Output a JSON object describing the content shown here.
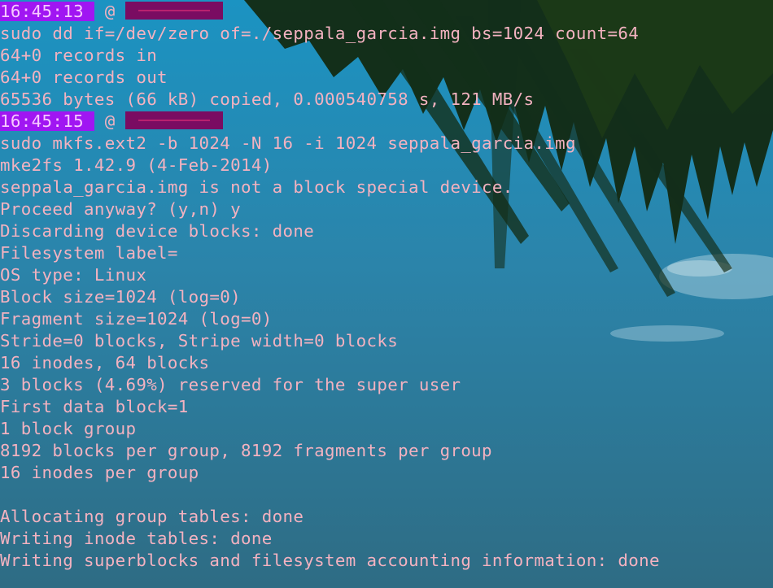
{
  "terminal": {
    "prompt_at": "@",
    "prompt_pad": " ",
    "lines": [
      {
        "type": "prompt",
        "time": "16:45:13"
      },
      {
        "type": "text",
        "text": "sudo dd if=/dev/zero of=./seppala_garcia.img bs=1024 count=64"
      },
      {
        "type": "text",
        "text": "64+0 records in"
      },
      {
        "type": "text",
        "text": "64+0 records out"
      },
      {
        "type": "text",
        "text": "65536 bytes (66 kB) copied, 0.000540758 s, 121 MB/s"
      },
      {
        "type": "prompt",
        "time": "16:45:15"
      },
      {
        "type": "text",
        "text": "sudo mkfs.ext2 -b 1024 -N 16 -i 1024 seppala_garcia.img"
      },
      {
        "type": "text",
        "text": "mke2fs 1.42.9 (4-Feb-2014)"
      },
      {
        "type": "text",
        "text": "seppala_garcia.img is not a block special device."
      },
      {
        "type": "text",
        "text": "Proceed anyway? (y,n) y"
      },
      {
        "type": "text",
        "text": "Discarding device blocks: done"
      },
      {
        "type": "text",
        "text": "Filesystem label="
      },
      {
        "type": "text",
        "text": "OS type: Linux"
      },
      {
        "type": "text",
        "text": "Block size=1024 (log=0)"
      },
      {
        "type": "text",
        "text": "Fragment size=1024 (log=0)"
      },
      {
        "type": "text",
        "text": "Stride=0 blocks, Stripe width=0 blocks"
      },
      {
        "type": "text",
        "text": "16 inodes, 64 blocks"
      },
      {
        "type": "text",
        "text": "3 blocks (4.69%) reserved for the super user"
      },
      {
        "type": "text",
        "text": "First data block=1"
      },
      {
        "type": "text",
        "text": "1 block group"
      },
      {
        "type": "text",
        "text": "8192 blocks per group, 8192 fragments per group"
      },
      {
        "type": "text",
        "text": "16 inodes per group"
      },
      {
        "type": "text",
        "text": ""
      },
      {
        "type": "text",
        "text": "Allocating group tables: done"
      },
      {
        "type": "text",
        "text": "Writing inode tables: done"
      },
      {
        "type": "text",
        "text": "Writing superblocks and filesystem accounting information: done"
      }
    ]
  },
  "colors": {
    "text": "#f3b2c0",
    "prompt_time_bg": "#a016f2",
    "prompt_host_redacted": "#7a0c62",
    "sky": "#2a85ac",
    "palm_leaves": "#0f1f0c"
  },
  "background": {
    "description_icon": "palm-leaves-over-sky-wallpaper"
  }
}
